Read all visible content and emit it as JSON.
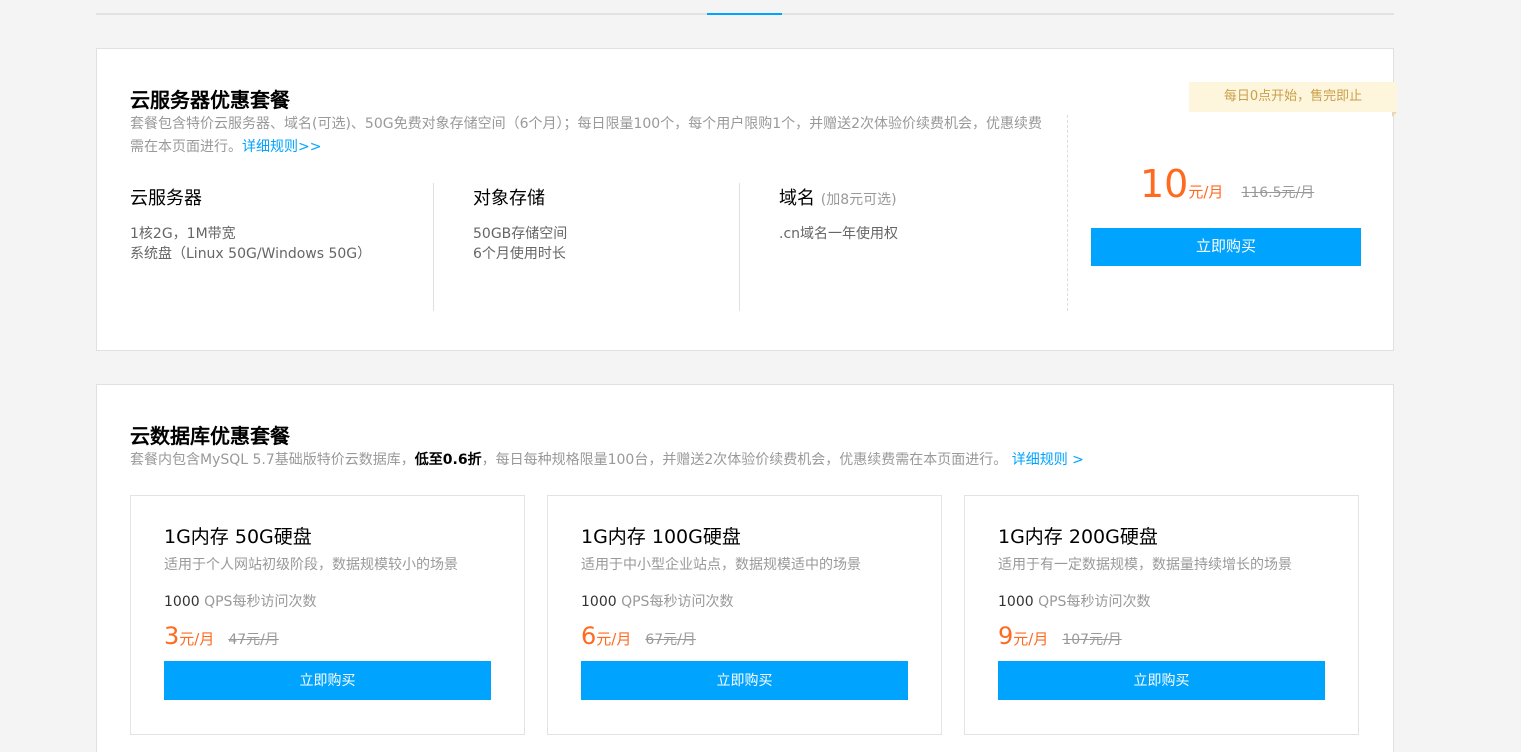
{
  "colors": {
    "accent": "#00a4ff",
    "price": "#ff6a1f",
    "badge_bg": "#fdf5dc",
    "badge_text": "#c9a04a"
  },
  "server": {
    "title": "云服务器优惠套餐",
    "desc": "套餐包含特价云服务器、域名(可选)、50G免费对象存储空间（6个月）；每日限量100个，每个用户限购1个，并赠送2次体验价续费机会，优惠续费需在本页面进行。",
    "rules_link": "详细规则>>",
    "badge": "每日0点开始，售完即止",
    "columns": [
      {
        "title": "云服务器",
        "note": "",
        "lines": [
          "1核2G，1M带宽",
          "系统盘（Linux 50G/Windows 50G）"
        ]
      },
      {
        "title": "对象存储",
        "note": "",
        "lines": [
          "50GB存储空间",
          "6个月使用时长"
        ]
      },
      {
        "title": "域名",
        "note": "(加8元可选)",
        "lines": [
          ".cn域名一年使用权"
        ]
      }
    ],
    "price": "10",
    "unit": "元/月",
    "old_price": "116.5元/月",
    "buy_label": "立即购买"
  },
  "db": {
    "title": "云数据库优惠套餐",
    "desc_before": "套餐内包含MySQL 5.7基础版特价云数据库，",
    "desc_strong": "低至0.6折",
    "desc_after": "，每日每种规格限量100台，并赠送2次体验价续费机会，优惠续费需在本页面进行。",
    "rules_link": "详细规则 >",
    "cards": [
      {
        "title": "1G内存 50G硬盘",
        "desc": "适用于个人网站初级阶段，数据规模较小的场景",
        "qps_num": "1000",
        "qps_label": " QPS每秒访问次数",
        "price": "3",
        "unit": "元/月",
        "old_price": "47元/月",
        "buy_label": "立即购买"
      },
      {
        "title": "1G内存 100G硬盘",
        "desc": "适用于中小型企业站点，数据规模适中的场景",
        "qps_num": "1000",
        "qps_label": " QPS每秒访问次数",
        "price": "6",
        "unit": "元/月",
        "old_price": "67元/月",
        "buy_label": "立即购买"
      },
      {
        "title": "1G内存 200G硬盘",
        "desc": "适用于有一定数据规模，数据量持续增长的场景",
        "qps_num": "1000",
        "qps_label": " QPS每秒访问次数",
        "price": "9",
        "unit": "元/月",
        "old_price": "107元/月",
        "buy_label": "立即购买"
      }
    ]
  }
}
